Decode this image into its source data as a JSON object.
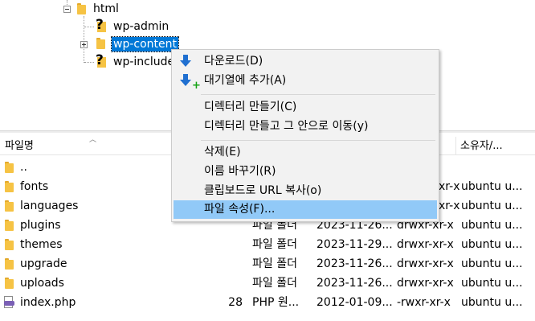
{
  "tree": {
    "items": [
      {
        "label": "html"
      },
      {
        "label": "wp-admin"
      },
      {
        "label": "wp-content"
      },
      {
        "label": "wp-include"
      }
    ]
  },
  "list": {
    "columns": {
      "name": "파일명",
      "owner": "소유자/..."
    },
    "rows": [
      {
        "name": "..",
        "size": "",
        "type": "",
        "date": "",
        "perm": "",
        "owner": ""
      },
      {
        "name": "fonts",
        "size": "",
        "type": "",
        "date": "",
        "perm": "xr-x",
        "owner": "ubuntu u..."
      },
      {
        "name": "languages",
        "size": "",
        "type": "",
        "date": "",
        "perm": "xr-x",
        "owner": "ubuntu u..."
      },
      {
        "name": "plugins",
        "size": "",
        "type": "파일 폴더",
        "date": "2023-11-26...",
        "perm": "drwxr-xr-x",
        "owner": "ubuntu u..."
      },
      {
        "name": "themes",
        "size": "",
        "type": "파일 폴더",
        "date": "2023-11-29...",
        "perm": "drwxr-xr-x",
        "owner": "ubuntu u..."
      },
      {
        "name": "upgrade",
        "size": "",
        "type": "파일 폴더",
        "date": "2023-11-26...",
        "perm": "drwxr-xr-x",
        "owner": "ubuntu u..."
      },
      {
        "name": "uploads",
        "size": "",
        "type": "파일 폴더",
        "date": "2023-11-26...",
        "perm": "drwxr-xr-x",
        "owner": "ubuntu u..."
      },
      {
        "name": "index.php",
        "size": "28",
        "type": "PHP 원...",
        "date": "2012-01-09...",
        "perm": "-rwxr-xr-x",
        "owner": "ubuntu u..."
      }
    ]
  },
  "context_menu": {
    "items": [
      {
        "label": "다운로드(D)",
        "icon": "download-icon"
      },
      {
        "label": "대기열에 추가(A)",
        "icon": "add-to-queue-icon"
      },
      {
        "label": "디렉터리 만들기(C)"
      },
      {
        "label": "디렉터리 만들고 그 안으로 이동(y)"
      },
      {
        "label": "삭제(E)"
      },
      {
        "label": "이름 바꾸기(R)"
      },
      {
        "label": "클립보드로 URL 복사(o)"
      },
      {
        "label": "파일 속성(F)..."
      }
    ],
    "highlighted": "파일 속성(F)...",
    "highlight_color": "#91c9f7"
  },
  "colors": {
    "selection": "#0078d7",
    "folder": "#f6c344"
  }
}
